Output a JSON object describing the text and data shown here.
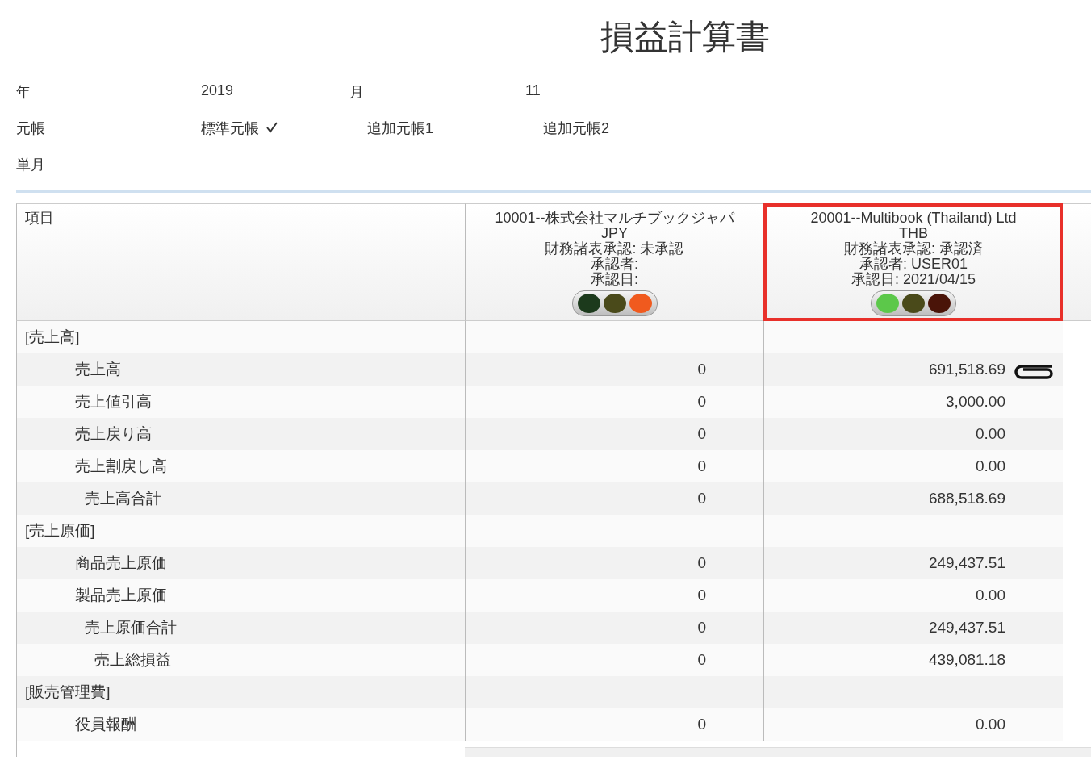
{
  "title": "損益計算書",
  "filters": {
    "year_label": "年",
    "year": "2019",
    "month_label": "月",
    "month": "11",
    "ledger_label": "元帳",
    "ledgers": [
      {
        "label": "標準元帳",
        "selected": true
      },
      {
        "label": "追加元帳1",
        "selected": false
      },
      {
        "label": "追加元帳2",
        "selected": false
      }
    ],
    "period": "単月"
  },
  "table": {
    "item_header": "項目",
    "columns": [
      {
        "lines": [
          "10001--株式会社マルチブックジャパ",
          "JPY",
          "財務諸表承認: 未承認",
          "承認者:",
          "承認日:"
        ],
        "highlighted": false,
        "lights": [
          {
            "color": "#1c3a1c"
          },
          {
            "color": "#4a4a1a"
          },
          {
            "color": "#f05a1e"
          }
        ]
      },
      {
        "lines": [
          "20001--Multibook (Thailand) Ltd",
          "THB",
          "財務諸表承認: 承認済",
          "承認者: USER01",
          "承認日: 2021/04/15"
        ],
        "highlighted": true,
        "lights": [
          {
            "color": "#5cc84a"
          },
          {
            "color": "#4a4a1a"
          },
          {
            "color": "#4a1408"
          }
        ]
      }
    ],
    "rows": [
      {
        "kind": "section",
        "label": "[売上高]"
      },
      {
        "kind": "item",
        "label": "売上高",
        "values": [
          "0",
          "691,518.69"
        ],
        "attachment": true
      },
      {
        "kind": "item",
        "label": "売上値引高",
        "values": [
          "0",
          "3,000.00"
        ]
      },
      {
        "kind": "item",
        "label": "売上戻り高",
        "values": [
          "0",
          "0.00"
        ]
      },
      {
        "kind": "item",
        "label": "売上割戻し高",
        "values": [
          "0",
          "0.00"
        ]
      },
      {
        "kind": "subtotal",
        "label": "売上高合計",
        "values": [
          "0",
          "688,518.69"
        ]
      },
      {
        "kind": "section",
        "label": "[売上原価]"
      },
      {
        "kind": "item",
        "label": "商品売上原価",
        "values": [
          "0",
          "249,437.51"
        ]
      },
      {
        "kind": "item",
        "label": "製品売上原価",
        "values": [
          "0",
          "0.00"
        ]
      },
      {
        "kind": "subtotal",
        "label": "売上原価合計",
        "values": [
          "0",
          "249,437.51"
        ]
      },
      {
        "kind": "total",
        "label": "売上総損益",
        "values": [
          "0",
          "439,081.18"
        ]
      },
      {
        "kind": "section",
        "label": "[販売管理費]"
      },
      {
        "kind": "item",
        "label": "役員報酬",
        "values": [
          "0",
          "0.00"
        ]
      }
    ]
  }
}
